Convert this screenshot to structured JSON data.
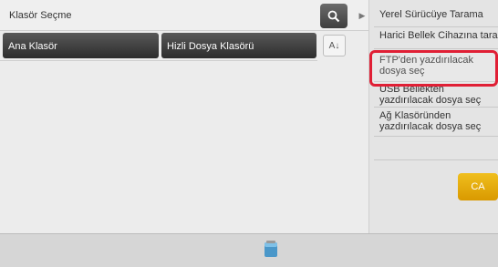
{
  "title": "Klasör Seçme",
  "folders": [
    {
      "label": "Ana Klasör"
    },
    {
      "label": "Hizli Dosya Klasörü"
    }
  ],
  "sort_label": "A↓",
  "side_menu": {
    "items": [
      {
        "label": "Yerel Sürücüye Tarama"
      },
      {
        "label": "Harici Bellek Cihazına tara"
      },
      {
        "label": "FTP'den yazdırılacak dosya seç"
      },
      {
        "label": "USB Bellekten yazdırılacak dosya seç"
      },
      {
        "label": "Ağ Klasöründen yazdırılacak dosya seç"
      }
    ],
    "ca_label": "CA"
  },
  "colors": {
    "highlight": "#e01f35",
    "ca_button": "#e6a800",
    "dark_button": "#3f3f3f"
  }
}
